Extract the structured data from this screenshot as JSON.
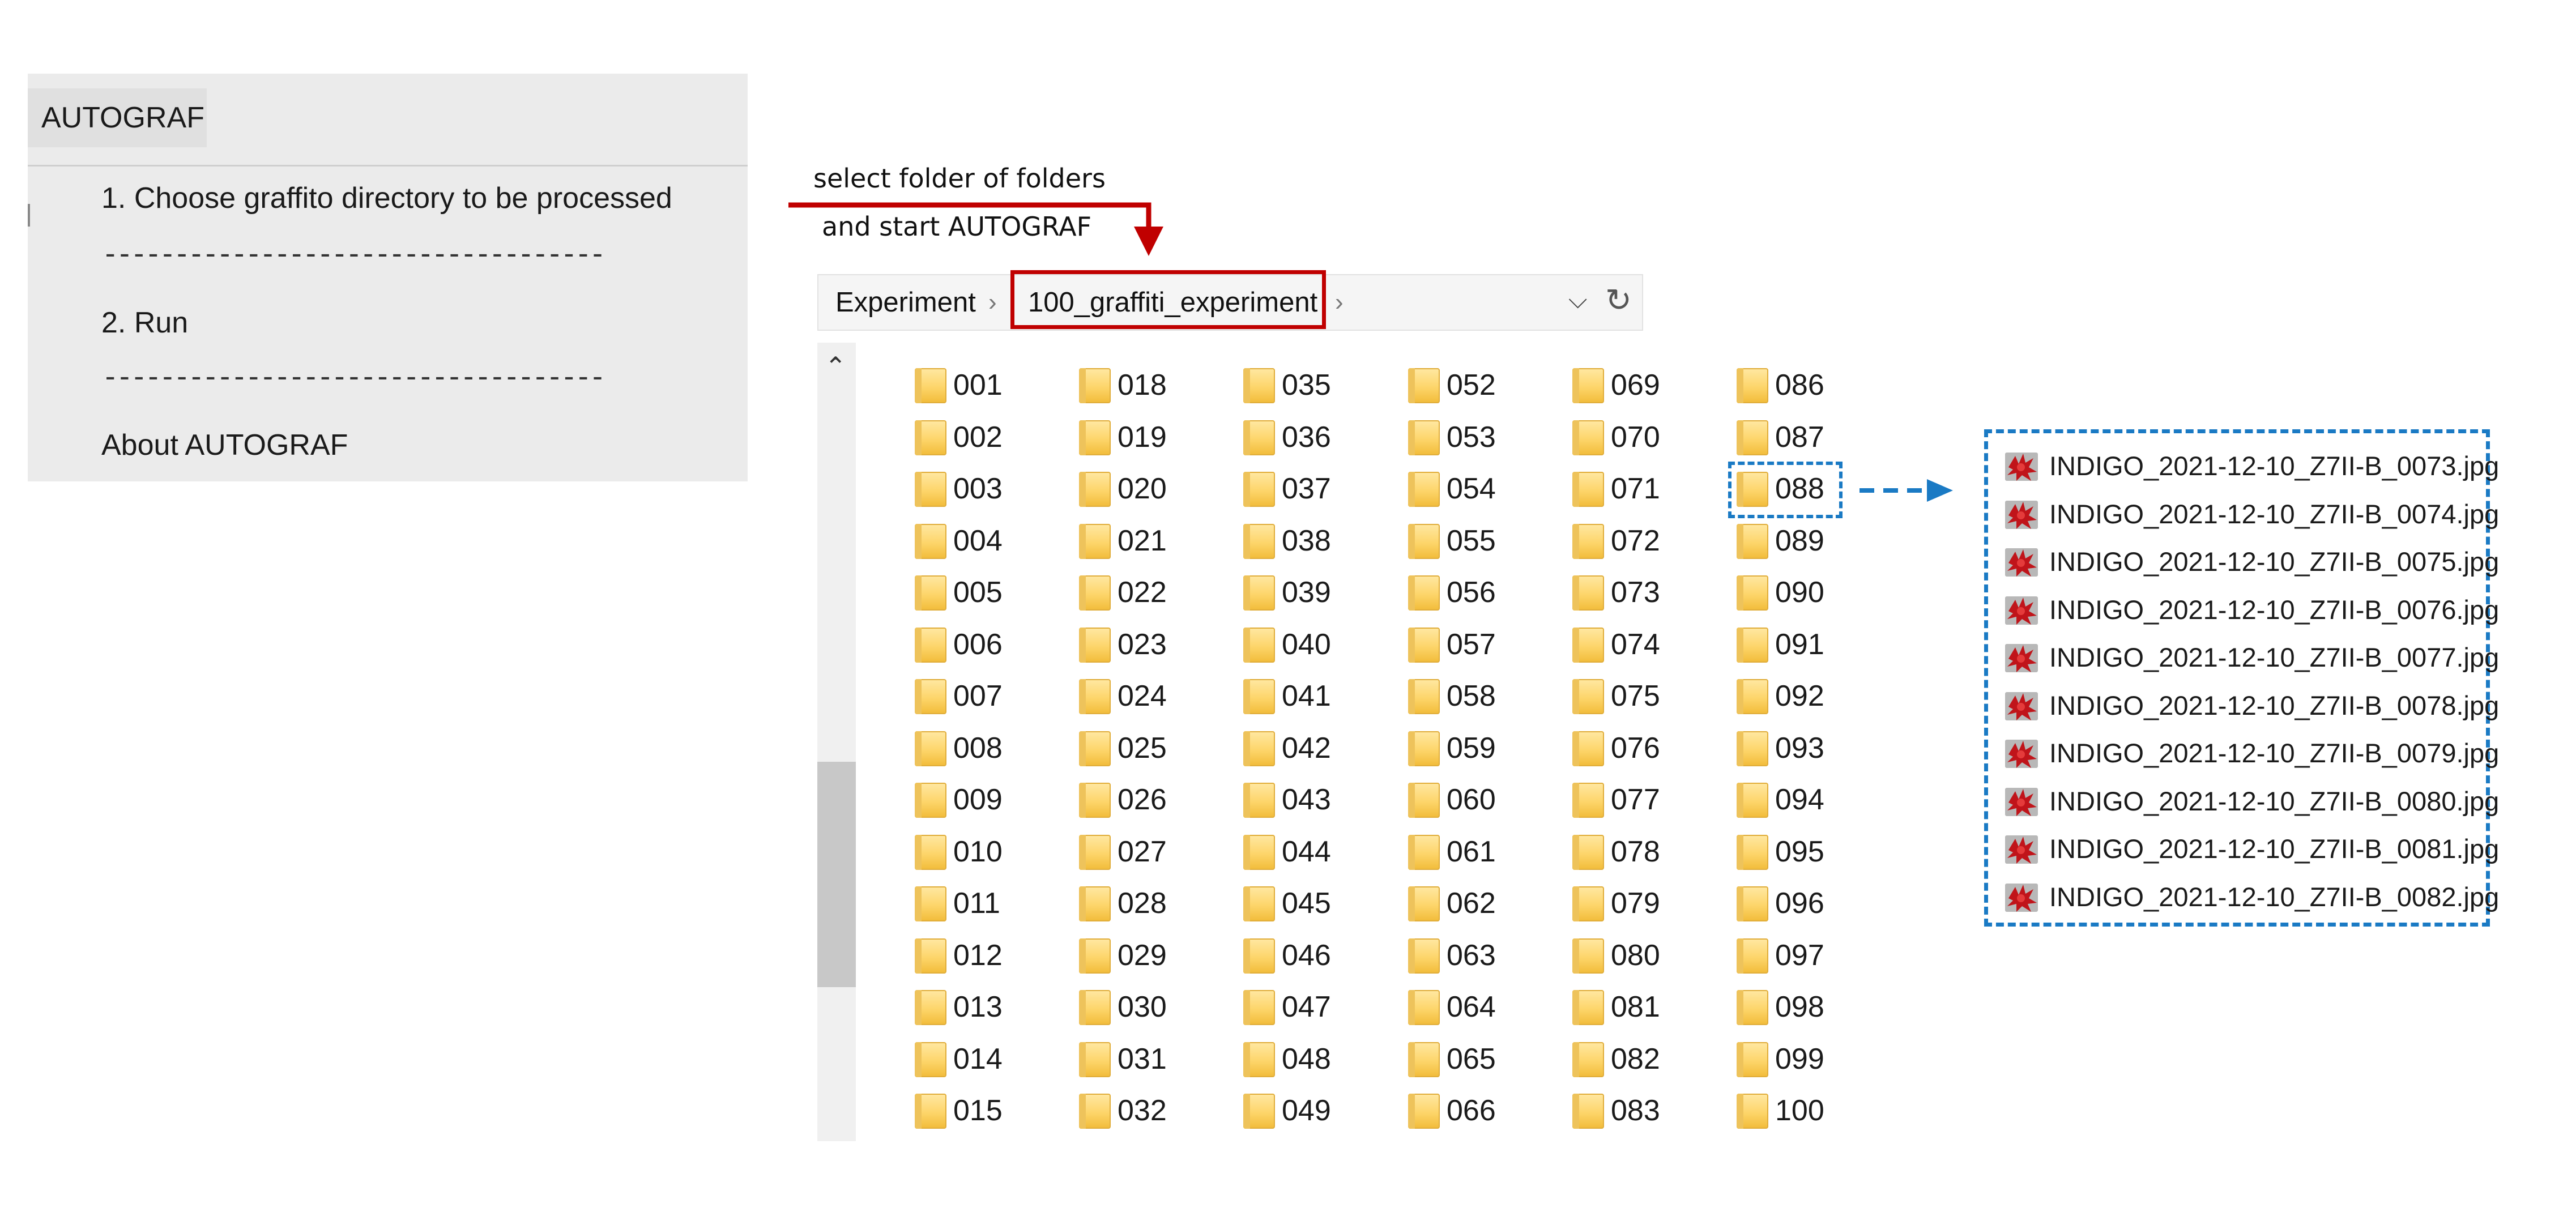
{
  "menu": {
    "title": "AUTOGRAF",
    "items": [
      "1. Choose graffito directory to be processed",
      "-----------------------------------",
      "2. Run",
      "-----------------------------------",
      "About AUTOGRAF"
    ]
  },
  "annotations": {
    "line1": "select folder of folders",
    "line2": "and start AUTOGRAF",
    "arrow_color": "#c00000",
    "link_color": "#1a7ac4"
  },
  "explorer": {
    "breadcrumb": [
      "Experiment",
      "100_graffiti_experiment"
    ],
    "dropdown_icon": "chevron-down-icon",
    "refresh_icon": "refresh-icon",
    "folders": [
      "001",
      "002",
      "003",
      "004",
      "005",
      "006",
      "007",
      "008",
      "009",
      "010",
      "011",
      "012",
      "013",
      "014",
      "015",
      "018",
      "019",
      "020",
      "021",
      "022",
      "023",
      "024",
      "025",
      "026",
      "027",
      "028",
      "029",
      "030",
      "031",
      "032",
      "035",
      "036",
      "037",
      "038",
      "039",
      "040",
      "041",
      "042",
      "043",
      "044",
      "045",
      "046",
      "047",
      "048",
      "049",
      "052",
      "053",
      "054",
      "055",
      "056",
      "057",
      "058",
      "059",
      "060",
      "061",
      "062",
      "063",
      "064",
      "065",
      "066",
      "069",
      "070",
      "071",
      "072",
      "073",
      "074",
      "075",
      "076",
      "077",
      "078",
      "079",
      "080",
      "081",
      "082",
      "083",
      "086",
      "087",
      "088",
      "089",
      "090",
      "091",
      "092",
      "093",
      "094",
      "095",
      "096",
      "097",
      "098",
      "099",
      "100"
    ],
    "highlighted_folder": "088"
  },
  "files": [
    "INDIGO_2021-12-10_Z7II-B_0073.jpg",
    "INDIGO_2021-12-10_Z7II-B_0074.jpg",
    "INDIGO_2021-12-10_Z7II-B_0075.jpg",
    "INDIGO_2021-12-10_Z7II-B_0076.jpg",
    "INDIGO_2021-12-10_Z7II-B_0077.jpg",
    "INDIGO_2021-12-10_Z7II-B_0078.jpg",
    "INDIGO_2021-12-10_Z7II-B_0079.jpg",
    "INDIGO_2021-12-10_Z7II-B_0080.jpg",
    "INDIGO_2021-12-10_Z7II-B_0081.jpg",
    "INDIGO_2021-12-10_Z7II-B_0082.jpg"
  ]
}
